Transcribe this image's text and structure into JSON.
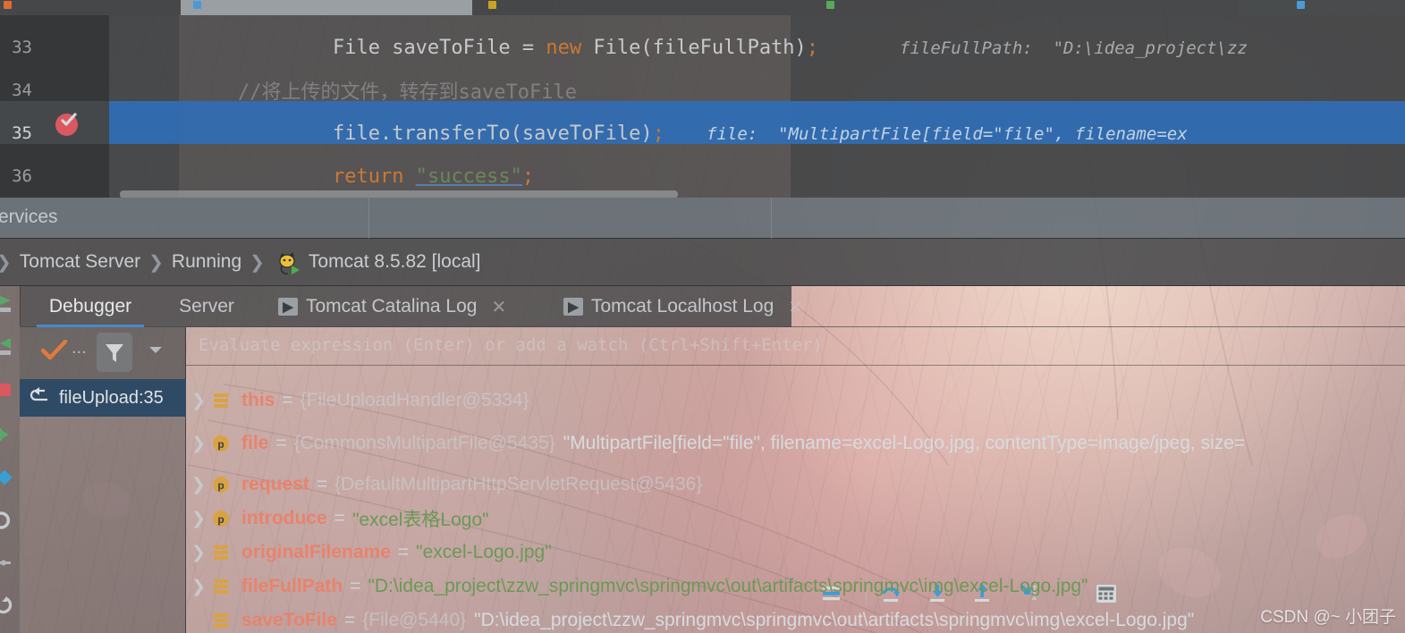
{
  "editor": {
    "tabstrip": {
      "visible_tabs": [
        "...",
        "...",
        "..."
      ]
    },
    "lines": [
      {
        "number": "33",
        "tokens": [
          {
            "t": "File saveToFile = ",
            "c": "k-white"
          },
          {
            "t": "new",
            "c": "k-orange"
          },
          {
            "t": " File(fileFullPath)",
            "c": "k-white"
          },
          {
            "t": ";",
            "c": "k-semi"
          }
        ],
        "hint": "fileFullPath:  \"D:\\idea_project\\zz"
      },
      {
        "number": "34",
        "tokens": [
          {
            "t": "//将上传的文件，转存到saveToFile",
            "c": "k-gray"
          }
        ],
        "hint": ""
      },
      {
        "number": "35",
        "tokens": [
          {
            "t": "file.transferTo(saveToFile)",
            "c": "k-white"
          },
          {
            "t": ";",
            "c": "k-semi"
          }
        ],
        "hint": "file:  \"MultipartFile[field=\"file\", filename=ex"
      },
      {
        "number": "36",
        "tokens": [
          {
            "t": "return",
            "c": "k-orange"
          },
          {
            "t": " ",
            "c": "k-white"
          },
          {
            "t": "\"success\"",
            "c": "k-green"
          },
          {
            "t": ";",
            "c": "k-semi"
          }
        ],
        "hint": ""
      }
    ],
    "breakpoint_icon": "breakpoint-verified-icon"
  },
  "services": {
    "title": "Services"
  },
  "breadcrumb": {
    "items": [
      "Tomcat Server",
      "Running",
      "Tomcat 8.5.82 [local]"
    ],
    "separator": "❯",
    "server_icon": "tomcat-cat-icon"
  },
  "left_toolbar": {
    "items": [
      {
        "name": "resume-program-icon",
        "label": "Resume Program"
      },
      {
        "name": "pause-program-icon",
        "label": "Pause Program"
      },
      {
        "name": "stop-icon",
        "label": "Stop"
      },
      {
        "name": "step-over-frame-icon",
        "label": "Step"
      },
      {
        "name": "view-breakpoints-icon",
        "label": "View Breakpoints"
      },
      {
        "name": "mute-breakpoints-icon",
        "label": "Mute Breakpoints"
      },
      {
        "name": "restore-layout-icon",
        "label": "Restore Layout"
      },
      {
        "name": "settings-icon",
        "label": "Settings"
      }
    ]
  },
  "debug_tabs": [
    {
      "label": "Debugger",
      "active": true,
      "has_console_badge": false,
      "closable": false
    },
    {
      "label": "Server",
      "active": false,
      "has_console_badge": false,
      "closable": false
    },
    {
      "label": "Tomcat Catalina Log",
      "active": false,
      "has_console_badge": true,
      "closable": true
    },
    {
      "label": "Tomcat Localhost Log",
      "active": false,
      "has_console_badge": true,
      "closable": true
    }
  ],
  "debug_toolbar": [
    {
      "name": "show-execution-point-icon",
      "label": "Show Execution Point"
    },
    {
      "name": "step-over-icon",
      "label": "Step Over"
    },
    {
      "name": "step-into-icon",
      "label": "Step Into"
    },
    {
      "name": "step-out-icon",
      "label": "Step Out"
    },
    {
      "name": "run-to-cursor-icon",
      "label": "Run to Cursor"
    },
    {
      "name": "evaluate-expression-icon",
      "label": "Evaluate Expression"
    }
  ],
  "frames": {
    "toolbar": {
      "threads_icon": "checkmark-icon",
      "more_label": "...",
      "filter_icon": "filter-icon",
      "dropdown_icon": "chevron-down-icon"
    },
    "selected": {
      "icon": "return-arrow-icon",
      "label": "fileUpload:35"
    }
  },
  "watch": {
    "placeholder": "Evaluate expression (Enter) or add a watch (Ctrl+Shift+Enter)"
  },
  "variables": [
    {
      "icon": "field-icon",
      "expandable": true,
      "name": "this",
      "eq": "=",
      "ref": "{FileUploadHandler@5334}",
      "value": "",
      "value_style": "none"
    },
    {
      "icon": "parameter-icon",
      "expandable": true,
      "name": "file",
      "eq": "=",
      "ref": "{CommonsMultipartFile@5435}",
      "value": "\"MultipartFile[field=\"file\", filename=excel-Logo.jpg, contentType=image/jpeg, size=",
      "value_style": "white"
    },
    {
      "icon": "parameter-icon",
      "expandable": true,
      "name": "request",
      "eq": "=",
      "ref": "{DefaultMultipartHttpServletRequest@5436}",
      "value": "",
      "value_style": "none"
    },
    {
      "icon": "parameter-icon",
      "expandable": true,
      "name": "introduce",
      "eq": "=",
      "ref": "",
      "value": "\"excel表格Logo\"",
      "value_style": "string"
    },
    {
      "icon": "field-icon",
      "expandable": true,
      "name": "originalFilename",
      "eq": "=",
      "ref": "",
      "value": "\"excel-Logo.jpg\"",
      "value_style": "string"
    },
    {
      "icon": "field-icon",
      "expandable": true,
      "name": "fileFullPath",
      "eq": "=",
      "ref": "",
      "value": "\"D:\\idea_project\\zzw_springmvc\\springmvc\\out\\artifacts\\springmvc\\img\\excel-Logo.jpg\"",
      "value_style": "string"
    },
    {
      "icon": "field-icon",
      "expandable": false,
      "name": "saveToFile",
      "eq": "=",
      "ref": "{File@5440}",
      "value": "\"D:\\idea_project\\zzw_springmvc\\springmvc\\out\\artifacts\\springmvc\\img\\excel-Logo.jpg\"",
      "value_style": "white"
    }
  ],
  "watermark": "CSDN @~ 小团子",
  "colors": {
    "exec_line_highlight": "#306EB5",
    "breakpoint": "#DB5860",
    "tab_underline": "#4A88C7",
    "frame_selected": "#2F4A64",
    "var_name": "#E8836D",
    "string_value": "#6A9955",
    "keyword": "#CC7832",
    "icon_blue": "#389FD6",
    "icon_green": "#59A869",
    "icon_red": "#DB5860",
    "icon_yellow": "#D9A343"
  }
}
